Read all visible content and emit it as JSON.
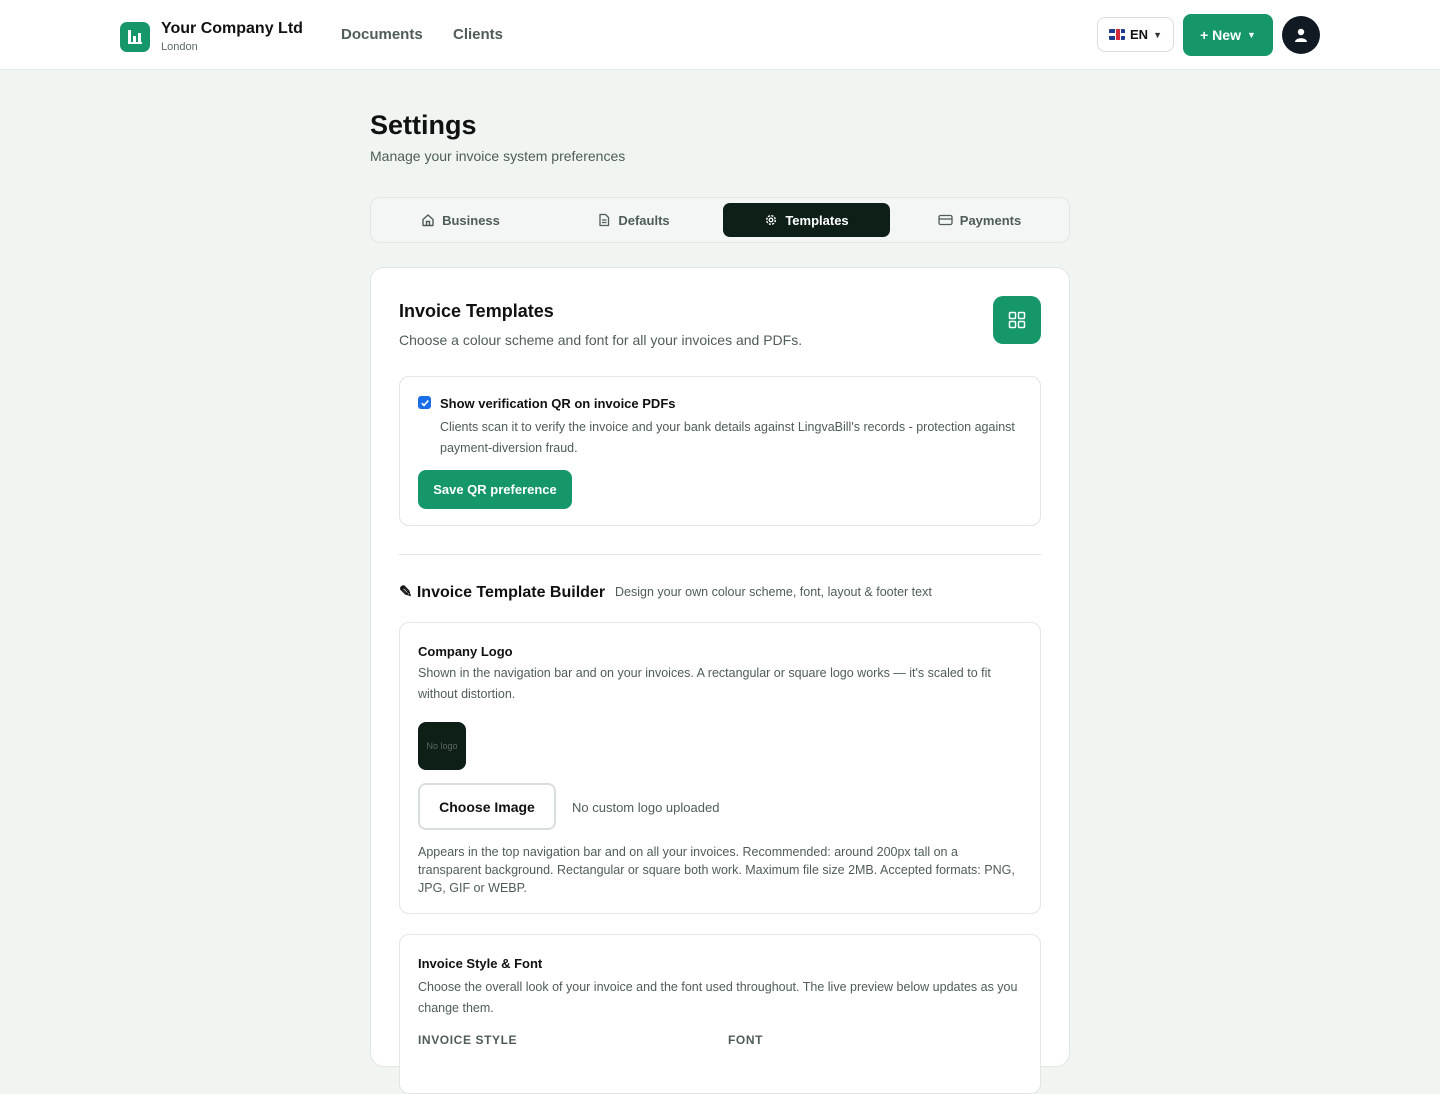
{
  "nav": {
    "company_name": "Your Company Ltd",
    "company_city": "London",
    "links": [
      "Documents",
      "Clients"
    ],
    "language": "EN",
    "new_label": "+ New"
  },
  "header": {
    "title": "Settings",
    "subtitle": "Manage your invoice system preferences"
  },
  "tabs": [
    {
      "label": "Business",
      "icon": "home-icon",
      "active": false
    },
    {
      "label": "Defaults",
      "icon": "document-icon",
      "active": false
    },
    {
      "label": "Templates",
      "icon": "gear-icon",
      "active": true
    },
    {
      "label": "Payments",
      "icon": "credit-card-icon",
      "active": false
    }
  ],
  "templates": {
    "title": "Invoice Templates",
    "subtitle": "Choose a colour scheme and font for all your invoices and PDFs.",
    "qr": {
      "checked": true,
      "label": "Show verification QR on invoice PDFs",
      "description": "Clients scan it to verify the invoice and your bank details against LingvaBill's records - protection against payment-diversion fraud.",
      "save_label": "Save QR preference"
    },
    "builder": {
      "title": "✎ Invoice Template Builder",
      "subtitle": "Design your own colour scheme, font, layout & footer text"
    },
    "logo": {
      "title": "Company Logo",
      "description": "Shown in the navigation bar and on your invoices. A rectangular or square logo works — it's scaled to fit without distortion.",
      "placeholder": "No logo",
      "choose_label": "Choose Image",
      "status": "No custom logo uploaded",
      "help": "Appears in the top navigation bar and on all your invoices. Recommended: around 200px tall on a transparent background. Rectangular or square both work. Maximum file size 2MB. Accepted formats: PNG, JPG, GIF or WEBP."
    },
    "style": {
      "title": "Invoice Style & Font",
      "description": "Choose the overall look of your invoice and the font used throughout. The live preview below updates as you change them.",
      "style_label": "INVOICE STYLE",
      "font_label": "FONT"
    }
  },
  "colors": {
    "brand": "#15976a",
    "active_tab": "#0d1f17",
    "page_bg": "#f1f5f2"
  }
}
